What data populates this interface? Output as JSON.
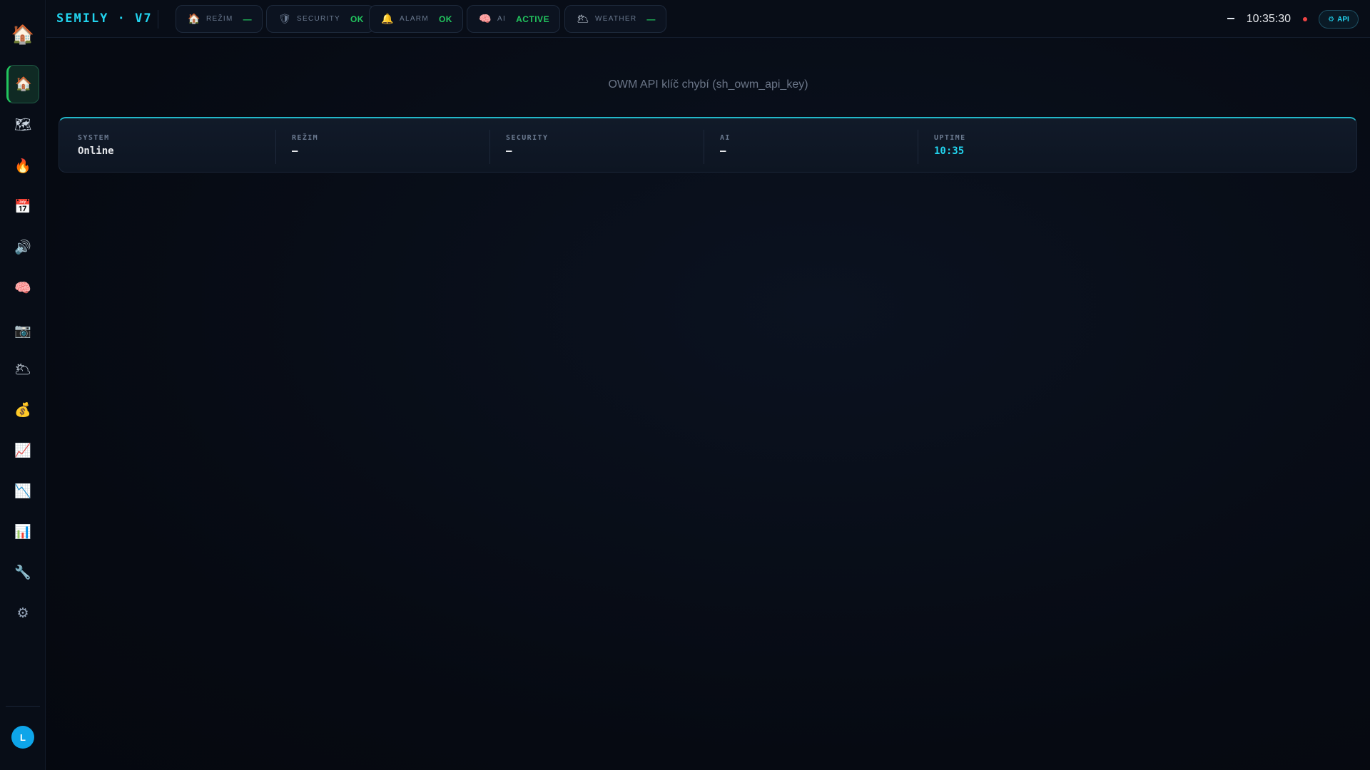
{
  "app": {
    "brand": "SEMILY · V7",
    "logo_icon": "🏠"
  },
  "sidebar": {
    "items": [
      {
        "name": "home",
        "icon": "🏠",
        "active": true
      },
      {
        "name": "map",
        "icon": "🗺"
      },
      {
        "name": "fire",
        "icon": "🔥"
      },
      {
        "name": "calendar",
        "icon": "📅"
      },
      {
        "name": "speaker",
        "icon": "🔊"
      },
      {
        "name": "brain",
        "icon": "🧠"
      },
      {
        "name": "camera",
        "icon": "📷"
      },
      {
        "name": "weather",
        "icon": "🌥"
      },
      {
        "name": "money",
        "icon": "💰"
      },
      {
        "name": "chart-up",
        "icon": "📈"
      },
      {
        "name": "chart-down",
        "icon": "📉"
      },
      {
        "name": "bar-chart",
        "icon": "📊"
      },
      {
        "name": "wrench",
        "icon": "🔧"
      },
      {
        "name": "settings",
        "icon": "⚙"
      }
    ],
    "user_initial": "L"
  },
  "topbar": {
    "pills": [
      {
        "icon": "🏠",
        "label": "REŽIM",
        "value": "—",
        "color": "#22c55e"
      },
      {
        "icon": "🛡",
        "label": "SECURITY",
        "value": "OK",
        "color": "#22c55e"
      },
      {
        "icon": "🔔",
        "label": "ALARM",
        "value": "OK",
        "color": "#22c55e"
      },
      {
        "icon": "🧠",
        "label": "AI",
        "value": "ACTIVE",
        "color": "#22c55e"
      },
      {
        "icon": "🌥",
        "label": "WEATHER",
        "value": "—",
        "color": "#22c55e"
      }
    ],
    "clock": "10:35:30",
    "api_label": "API",
    "api_icon": "⚙",
    "status_color": "#ef4444"
  },
  "main": {
    "notice": "OWM API klíč chybí (sh_owm_api_key)",
    "stats": [
      {
        "label": "SYSTEM",
        "value": "Online",
        "color": "#e5e7eb"
      },
      {
        "label": "REŽIM",
        "value": "—",
        "color": "#e5e7eb"
      },
      {
        "label": "SECURITY",
        "value": "—",
        "color": "#e5e7eb"
      },
      {
        "label": "AI",
        "value": "—",
        "color": "#e5e7eb"
      },
      {
        "label": "UPTIME",
        "value": "10:35",
        "color": "#22d3ee"
      }
    ]
  },
  "colors": {
    "accent": "#22d3ee",
    "ok": "#22c55e",
    "alert": "#ef4444"
  }
}
